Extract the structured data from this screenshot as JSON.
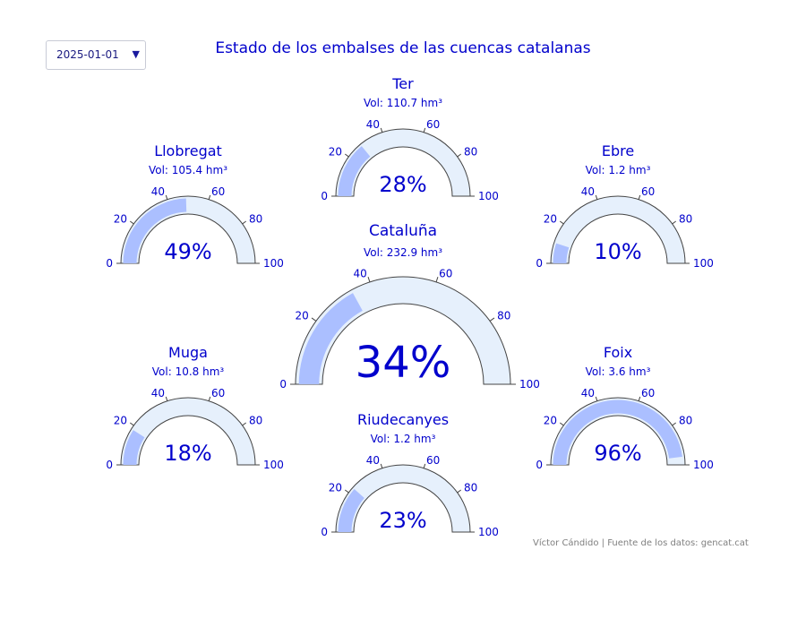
{
  "date_selector": {
    "value": "2025-01-01",
    "icon": "chevron-down-icon"
  },
  "title": "Estado de los embalses de las cuencas catalanas",
  "credit": "Víctor Cándido | Fuente de los datos: gencat.cat",
  "colors": {
    "text": "#0000cc",
    "track": "#e6f0fc",
    "bar": "#abbfff",
    "outline": "#444444"
  },
  "chart_data": {
    "type": "gauge",
    "range": [
      0,
      100
    ],
    "ticks": [
      "0",
      "20",
      "40",
      "60",
      "80",
      "100"
    ],
    "gauges": [
      {
        "id": "ter",
        "name": "Ter",
        "volume": "Vol: 110.7 hm³",
        "value": 28,
        "label": "28%"
      },
      {
        "id": "llobregat",
        "name": "Llobregat",
        "volume": "Vol: 105.4 hm³",
        "value": 49,
        "label": "49%"
      },
      {
        "id": "ebre",
        "name": "Ebre",
        "volume": "Vol: 1.2 hm³",
        "value": 10,
        "label": "10%"
      },
      {
        "id": "catalunya",
        "name": "Cataluña",
        "volume": "Vol: 232.9 hm³",
        "value": 34,
        "label": "34%"
      },
      {
        "id": "muga",
        "name": "Muga",
        "volume": "Vol: 10.8 hm³",
        "value": 18,
        "label": "18%"
      },
      {
        "id": "foix",
        "name": "Foix",
        "volume": "Vol: 3.6 hm³",
        "value": 96,
        "label": "96%"
      },
      {
        "id": "riudecanyes",
        "name": "Riudecanyes",
        "volume": "Vol: 1.2 hm³",
        "value": 23,
        "label": "23%"
      }
    ]
  }
}
